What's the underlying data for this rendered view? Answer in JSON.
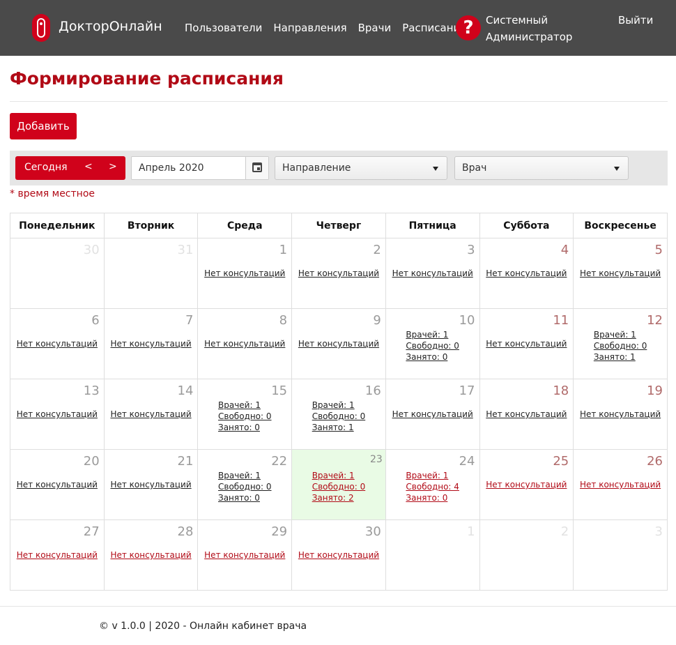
{
  "header": {
    "brand": "ДокторОнлайн",
    "nav": [
      "Пользователи",
      "Направления",
      "Врачи",
      "Расписание"
    ],
    "user_line1": "Системный",
    "user_line2": "Администратор",
    "logout": "Выйти",
    "help_glyph": "?"
  },
  "page": {
    "title": "Формирование расписания",
    "add_label": "Добавить",
    "note": "* время местное"
  },
  "toolbar": {
    "today": "Сегодня",
    "prev": "<",
    "next": ">",
    "date_value": "Апрель 2020",
    "direction_placeholder": "Направление",
    "doctor_placeholder": "Врач"
  },
  "calendar": {
    "weekdays": [
      "Понедельник",
      "Вторник",
      "Среда",
      "Четверг",
      "Пятница",
      "Суббота",
      "Воскресенье"
    ],
    "no_consult": "Нет консультаций",
    "weeks": [
      [
        {
          "day": "30",
          "outside": true
        },
        {
          "day": "31",
          "outside": true
        },
        {
          "day": "1",
          "text": "Нет консультаций"
        },
        {
          "day": "2",
          "text": "Нет консультаций"
        },
        {
          "day": "3",
          "text": "Нет консультаций"
        },
        {
          "day": "4",
          "weekend": true,
          "text": "Нет консультаций"
        },
        {
          "day": "5",
          "weekend": true,
          "text": "Нет консультаций"
        }
      ],
      [
        {
          "day": "6",
          "text": "Нет консультаций"
        },
        {
          "day": "7",
          "text": "Нет консультаций"
        },
        {
          "day": "8",
          "text": "Нет консультаций"
        },
        {
          "day": "9",
          "text": "Нет консультаций"
        },
        {
          "day": "10",
          "stats": [
            "Врачей: 1",
            "Свободно: 0",
            "Занято: 0"
          ]
        },
        {
          "day": "11",
          "weekend": true,
          "text": "Нет консультаций"
        },
        {
          "day": "12",
          "weekend": true,
          "stats": [
            "Врачей: 1",
            "Свободно: 0",
            "Занято: 1"
          ]
        }
      ],
      [
        {
          "day": "13",
          "text": "Нет консультаций"
        },
        {
          "day": "14",
          "text": "Нет консультаций"
        },
        {
          "day": "15",
          "stats": [
            "Врачей: 1",
            "Свободно: 0",
            "Занято: 0"
          ]
        },
        {
          "day": "16",
          "stats": [
            "Врачей: 1",
            "Свободно: 0",
            "Занято: 1"
          ]
        },
        {
          "day": "17",
          "text": "Нет консультаций"
        },
        {
          "day": "18",
          "weekend": true,
          "text": "Нет консультаций"
        },
        {
          "day": "19",
          "weekend": true,
          "text": "Нет консультаций"
        }
      ],
      [
        {
          "day": "20",
          "text": "Нет консультаций"
        },
        {
          "day": "21",
          "text": "Нет консультаций"
        },
        {
          "day": "22",
          "stats": [
            "Врачей: 1",
            "Свободно: 0",
            "Занято: 0"
          ]
        },
        {
          "day": "23",
          "today": true,
          "future": true,
          "stats": [
            "Врачей: 1",
            "Свободно: 0",
            "Занято: 2"
          ]
        },
        {
          "day": "24",
          "future": true,
          "stats": [
            "Врачей: 1",
            "Свободно: 4",
            "Занято: 0"
          ]
        },
        {
          "day": "25",
          "weekend": true,
          "future": true,
          "text": "Нет консультаций"
        },
        {
          "day": "26",
          "weekend": true,
          "future": true,
          "text": "Нет консультаций"
        }
      ],
      [
        {
          "day": "27",
          "future": true,
          "text": "Нет консультаций"
        },
        {
          "day": "28",
          "future": true,
          "text": "Нет консультаций"
        },
        {
          "day": "29",
          "future": true,
          "text": "Нет консультаций"
        },
        {
          "day": "30",
          "future": true,
          "text": "Нет консультаций"
        },
        {
          "day": "1",
          "outside": true
        },
        {
          "day": "2",
          "outside": true
        },
        {
          "day": "3",
          "outside": true
        }
      ]
    ]
  },
  "footer": {
    "text": "© v 1.0.0 | 2020 - Онлайн кабинет врача"
  },
  "colors": {
    "header_bg": "#4a4a4a",
    "accent": "#d0021b",
    "title": "#b10a16",
    "today_bg": "#e9fbe5"
  }
}
